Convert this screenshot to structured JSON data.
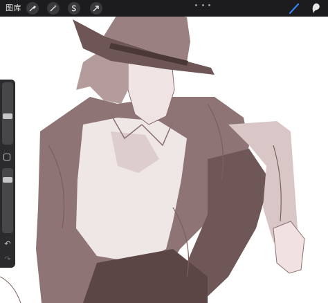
{
  "topbar": {
    "gallery_label": "图库",
    "tools_left": [
      "wrench-icon",
      "magic-wand-icon",
      "selection-s-icon",
      "transform-arrow-icon"
    ],
    "more_icon": "ellipsis-icon",
    "tools_right": [
      "brush-icon",
      "smudge-icon"
    ],
    "active_brush_color": "#3b82f6"
  },
  "sidebar": {
    "brush_size_level": 0.55,
    "opacity_level": 0.15,
    "modify_icon": "square-icon",
    "undo_icon": "undo-arrow-icon",
    "redo_icon": "redo-arrow-icon"
  },
  "canvas": {
    "subject": "sketch",
    "palette": [
      "#7a5f5c",
      "#a4898a",
      "#c9aeb0",
      "#4d3a3a",
      "#e4d2d3"
    ]
  }
}
